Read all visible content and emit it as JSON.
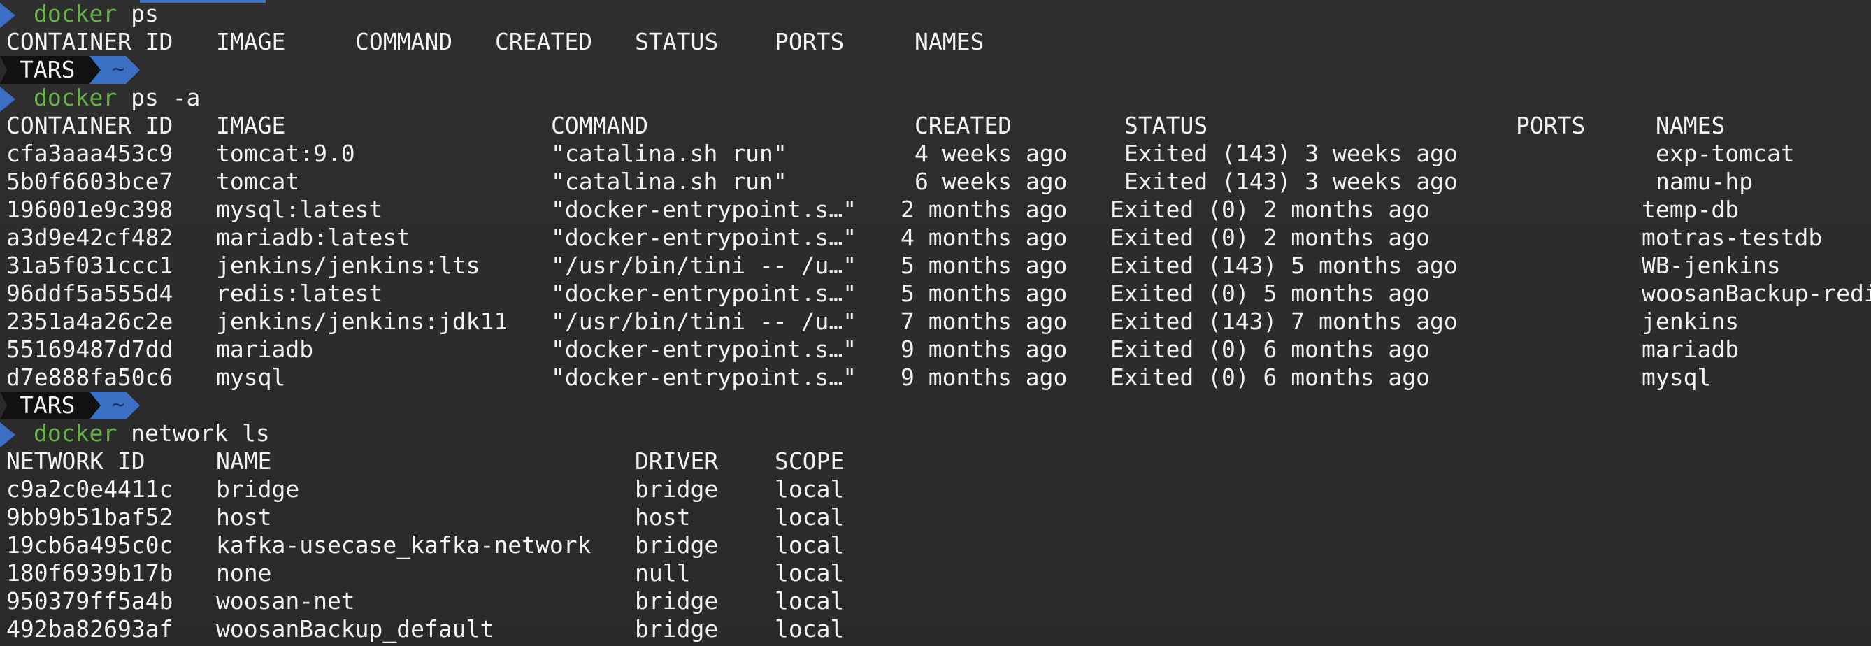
{
  "prompt": {
    "host": "TARS",
    "dir": "~",
    "command_word": "docker"
  },
  "cmd1": {
    "args": " ps"
  },
  "ps_headers": [
    "CONTAINER ID",
    "IMAGE",
    "COMMAND",
    "CREATED",
    "STATUS",
    "PORTS",
    "NAMES"
  ],
  "cmd2": {
    "args": " ps -a"
  },
  "psa_headers": [
    "CONTAINER ID",
    "IMAGE",
    "COMMAND",
    "CREATED",
    "STATUS",
    "PORTS",
    "NAMES"
  ],
  "containers": [
    {
      "id": "cfa3aaa453c9",
      "image": "tomcat:9.0",
      "command": "\"catalina.sh run\"",
      "created": "4 weeks ago",
      "status": "Exited (143) 3 weeks ago",
      "ports": "",
      "names": "exp-tomcat"
    },
    {
      "id": "5b0f6603bce7",
      "image": "tomcat",
      "command": "\"catalina.sh run\"",
      "created": "6 weeks ago",
      "status": "Exited (143) 3 weeks ago",
      "ports": "",
      "names": "namu-hp"
    },
    {
      "id": "196001e9c398",
      "image": "mysql:latest",
      "command": "\"docker-entrypoint.s…\"",
      "created": "2 months ago",
      "status": "Exited (0) 2 months ago",
      "ports": "",
      "names": "temp-db"
    },
    {
      "id": "a3d9e42cf482",
      "image": "mariadb:latest",
      "command": "\"docker-entrypoint.s…\"",
      "created": "4 months ago",
      "status": "Exited (0) 2 months ago",
      "ports": "",
      "names": "motras-testdb"
    },
    {
      "id": "31a5f031ccc1",
      "image": "jenkins/jenkins:lts",
      "command": "\"/usr/bin/tini -- /u…\"",
      "created": "5 months ago",
      "status": "Exited (143) 5 months ago",
      "ports": "",
      "names": "WB-jenkins"
    },
    {
      "id": "96ddf5a555d4",
      "image": "redis:latest",
      "command": "\"docker-entrypoint.s…\"",
      "created": "5 months ago",
      "status": "Exited (0) 5 months ago",
      "ports": "",
      "names": "woosanBackup-redi"
    },
    {
      "id": "2351a4a26c2e",
      "image": "jenkins/jenkins:jdk11",
      "command": "\"/usr/bin/tini -- /u…\"",
      "created": "7 months ago",
      "status": "Exited (143) 7 months ago",
      "ports": "",
      "names": "jenkins"
    },
    {
      "id": "55169487d7dd",
      "image": "mariadb",
      "command": "\"docker-entrypoint.s…\"",
      "created": "9 months ago",
      "status": "Exited (0) 6 months ago",
      "ports": "",
      "names": "mariadb"
    },
    {
      "id": "d7e888fa50c6",
      "image": "mysql",
      "command": "\"docker-entrypoint.s…\"",
      "created": "9 months ago",
      "status": "Exited (0) 6 months ago",
      "ports": "",
      "names": "mysql"
    }
  ],
  "cmd3": {
    "args": " network ls"
  },
  "net_headers": [
    "NETWORK ID",
    "NAME",
    "DRIVER",
    "SCOPE"
  ],
  "networks": [
    {
      "id": "c9a2c0e4411c",
      "name": "bridge",
      "driver": "bridge",
      "scope": "local"
    },
    {
      "id": "9bb9b51baf52",
      "name": "host",
      "driver": "host",
      "scope": "local"
    },
    {
      "id": "19cb6a495c0c",
      "name": "kafka-usecase_kafka-network",
      "driver": "bridge",
      "scope": "local"
    },
    {
      "id": "180f6939b17b",
      "name": "none",
      "driver": "null",
      "scope": "local"
    },
    {
      "id": "950379ff5a4b",
      "name": "woosan-net",
      "driver": "bridge",
      "scope": "local"
    },
    {
      "id": "492ba82693af",
      "name": "woosanBackup_default",
      "driver": "bridge",
      "scope": "local"
    }
  ],
  "colors": {
    "background": "#2b2b2b",
    "text": "#f2f2f2",
    "command": "#66b04a",
    "prompt_accent": "#3a6fc4",
    "prompt_dark": "#111111"
  }
}
